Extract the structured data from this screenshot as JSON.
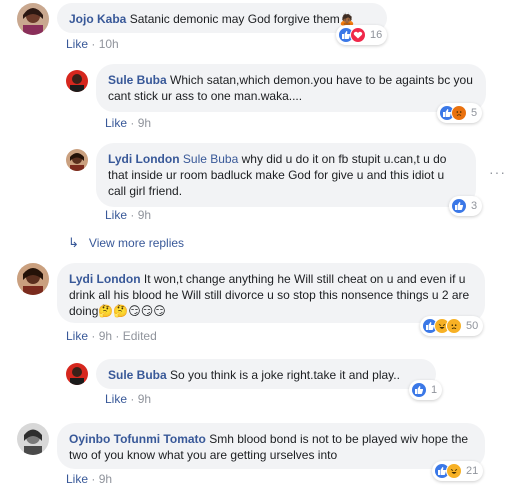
{
  "comments": [
    {
      "name": "Jojo Kaba",
      "text": "Satanic demonic may God forgive them🙇🏾",
      "like": "Like",
      "time": "10h",
      "reaction_count": "16"
    },
    {
      "name": "Sule Buba",
      "text": "Which satan,which demon.you have to be againts bc you cant stick ur ass to one man.waka....",
      "like": "Like",
      "time": "9h",
      "reaction_count": "5"
    },
    {
      "name": "Lydi London",
      "mention": "Sule Buba",
      "text": "why did u do it on fb stupit u.can,t u do that inside ur room badluck make God for give u and this idiot u call girl friend.",
      "like": "Like",
      "time": "9h",
      "reaction_count": "3",
      "more": "···"
    },
    {
      "name": "Lydi London",
      "text": "It won,t change anything he Will still cheat on u and even if u drink all his blood he Will still divorce u so stop this nonsence things u 2 are doing🤔🤔😏😏😏",
      "like": "Like",
      "time": "9h",
      "edited": "Edited",
      "reaction_count": "50"
    },
    {
      "name": "Sule Buba",
      "text": "So you think is a joke right.take it and play..",
      "like": "Like",
      "time": "9h",
      "reaction_count": "1"
    },
    {
      "name": "Oyinbo Tofunmi Tomato",
      "text": "Smh blood bond is not to be played wiv hope the two of you know what you are getting urselves into",
      "like": "Like",
      "time": "9h",
      "reaction_count": "21"
    }
  ],
  "view_more": "View more replies",
  "separator": "·",
  "colors": {
    "link": "#385898",
    "bubble": "#f2f3f5",
    "meta": "#90949c"
  }
}
